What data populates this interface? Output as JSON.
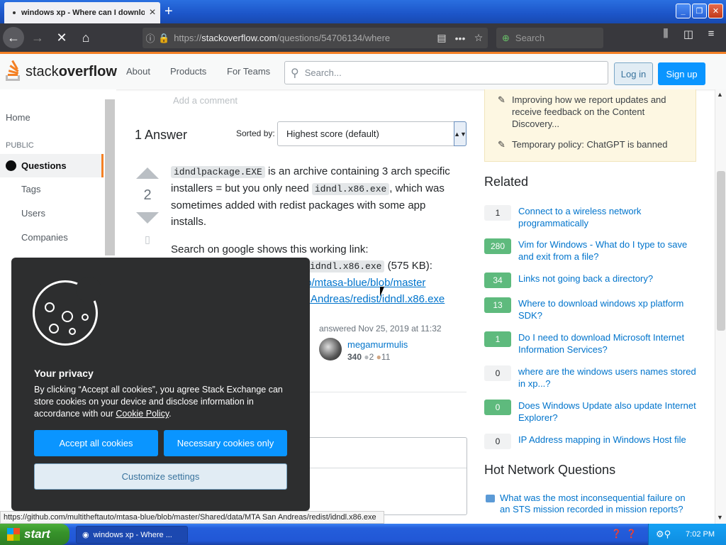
{
  "browser": {
    "tab_title": "windows xp - Where can I download",
    "url_prefix": "https://",
    "url_domain": "stackoverflow.com",
    "url_path": "/questions/54706134/where",
    "search_placeholder": "Search",
    "status_url": "https://github.com/multitheftauto/mtasa-blue/blob/master/Shared/data/MTA San Andreas/redist/idndl.x86.exe"
  },
  "so_header": {
    "logo_light": "stack",
    "logo_bold": "overflow",
    "nav": [
      "About",
      "Products",
      "For Teams"
    ],
    "search_placeholder": "Search...",
    "login": "Log in",
    "signup": "Sign up"
  },
  "left_nav": {
    "home": "Home",
    "public": "PUBLIC",
    "questions": "Questions",
    "tags": "Tags",
    "users": "Users",
    "companies": "Companies"
  },
  "main": {
    "add_comment": "Add a comment",
    "answers_heading": "1 Answer",
    "sorted_by": "Sorted by:",
    "sort_value": "Highest score (default)",
    "vote_count": "2",
    "answer": {
      "code1": "idndlpackage.EXE",
      "text1": " is an archive containing 3 arch specific installers = but you only need ",
      "code2": "idndl.x86.exe",
      "text2": ", which was sometimes added with redist packages with some app installs.",
      "search_text": "Search on google shows this working link:",
      "code3": "idndl.x86.exe",
      "size": " (575 KB):",
      "link_line1": "to/mtasa-blue/blob/master",
      "link_line2": ")Andreas/redist/idndl.x86.exe"
    },
    "answered": "answered Nov 25, 2019 at 11:32",
    "user_name": "megamurmulis",
    "user_rep": "340",
    "user_silver": "2",
    "user_bronze": "11"
  },
  "sidebar": {
    "meta_items": [
      "Improving how we report updates and receive feedback on the Content Discovery...",
      "Temporary policy: ChatGPT is banned"
    ],
    "related_heading": "Related",
    "related": [
      {
        "count": "1",
        "answered": false,
        "title": "Connect to a wireless network programmatically"
      },
      {
        "count": "280",
        "answered": true,
        "title": "Vim for Windows - What do I type to save and exit from a file?"
      },
      {
        "count": "34",
        "answered": true,
        "title": "Links not going back a directory?"
      },
      {
        "count": "13",
        "answered": true,
        "title": "Where to download windows xp platform SDK?"
      },
      {
        "count": "1",
        "answered": true,
        "title": "Do I need to download Microsoft Internet Information Services?"
      },
      {
        "count": "0",
        "answered": false,
        "title": "where are the windows users names stored in xp...?"
      },
      {
        "count": "0",
        "answered": true,
        "title": "Does Windows Update also update Internet Explorer?"
      },
      {
        "count": "0",
        "answered": false,
        "title": "IP Address mapping in Windows Host file"
      }
    ],
    "hnq_heading": "Hot Network Questions",
    "hnq_item": "What was the most inconsequential failure on an STS mission recorded in mission reports?"
  },
  "cookie": {
    "title": "Your privacy",
    "text": "By clicking “Accept all cookies”, you agree Stack Exchange can store cookies on your device and disclose information in accordance with our ",
    "link": "Cookie Policy",
    "accept": "Accept all cookies",
    "necessary": "Necessary cookies only",
    "customize": "Customize settings"
  },
  "taskbar": {
    "start": "start",
    "task": "windows xp - Where ...",
    "time": "7:02 PM"
  }
}
